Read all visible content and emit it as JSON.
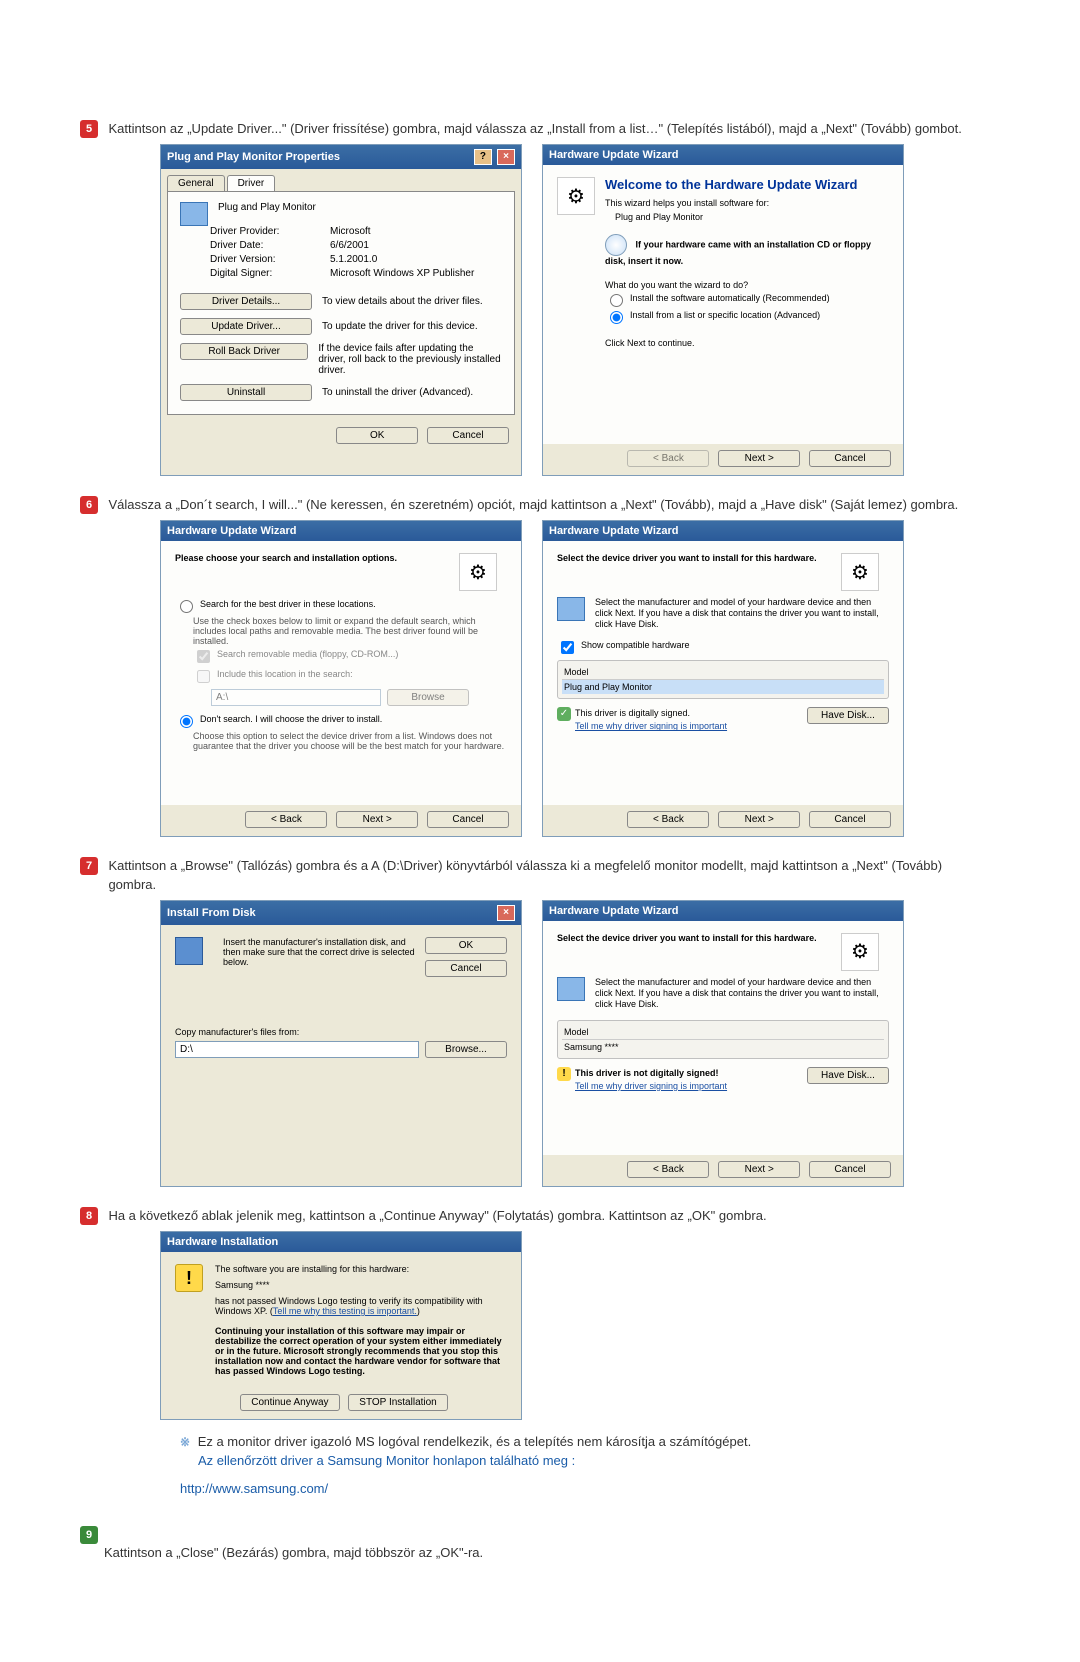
{
  "step5": {
    "num": "5",
    "text": "Kattintson az „Update Driver...\" (Driver frissítése) gombra, majd válassza az „Install from a list…\" (Telepítés listából), majd a „Next\" (Tovább) gombot.",
    "pnp": {
      "title": "Plug and Play Monitor Properties",
      "tab_general": "General",
      "tab_driver": "Driver",
      "device": "Plug and Play Monitor",
      "provider_l": "Driver Provider:",
      "provider_v": "Microsoft",
      "date_l": "Driver Date:",
      "date_v": "6/6/2001",
      "version_l": "Driver Version:",
      "version_v": "5.1.2001.0",
      "signer_l": "Digital Signer:",
      "signer_v": "Microsoft Windows XP Publisher",
      "details_btn": "Driver Details...",
      "details_txt": "To view details about the driver files.",
      "update_btn": "Update Driver...",
      "update_txt": "To update the driver for this device.",
      "rollback_btn": "Roll Back Driver",
      "rollback_txt": "If the device fails after updating the driver, roll back to the previously installed driver.",
      "uninstall_btn": "Uninstall",
      "uninstall_txt": "To uninstall the driver (Advanced).",
      "ok": "OK",
      "cancel": "Cancel"
    },
    "hw1": {
      "title": "Hardware Update Wizard",
      "heading": "Welcome to the Hardware Update Wizard",
      "intro": "This wizard helps you install software for:",
      "device": "Plug and Play Monitor",
      "cd_text": "If your hardware came with an installation CD or floppy disk, insert it now.",
      "question": "What do you want the wizard to do?",
      "opt1": "Install the software automatically (Recommended)",
      "opt2": "Install from a list or specific location (Advanced)",
      "continue": "Click Next to continue.",
      "back": "< Back",
      "next": "Next >",
      "cancel": "Cancel"
    }
  },
  "step6": {
    "num": "6",
    "text": "Válassza a „Don´t search, I will...\" (Ne keressen, én szeretném) opciót, majd kattintson a „Next\" (Tovább), majd a „Have disk\" (Saját lemez) gombra.",
    "hw2": {
      "title": "Hardware Update Wizard",
      "heading": "Please choose your search and installation options.",
      "opt1": "Search for the best driver in these locations.",
      "opt1_sub": "Use the check boxes below to limit or expand the default search, which includes local paths and removable media. The best driver found will be installed.",
      "chk1": "Search removable media (floppy, CD-ROM...)",
      "chk2": "Include this location in the search:",
      "path": "A:\\",
      "browse": "Browse",
      "opt2": "Don't search. I will choose the driver to install.",
      "opt2_sub": "Choose this option to select the device driver from a list. Windows does not guarantee that the driver you choose will be the best match for your hardware.",
      "back": "< Back",
      "next": "Next >",
      "cancel": "Cancel"
    },
    "hw3": {
      "title": "Hardware Update Wizard",
      "heading": "Select the device driver you want to install for this hardware.",
      "sub": "Select the manufacturer and model of your hardware device and then click Next. If you have a disk that contains the driver you want to install, click Have Disk.",
      "compat": "Show compatible hardware",
      "model_l": "Model",
      "model_v": "Plug and Play Monitor",
      "signed": "This driver is digitally signed.",
      "signed_link": "Tell me why driver signing is important",
      "have_disk": "Have Disk...",
      "back": "< Back",
      "next": "Next >",
      "cancel": "Cancel"
    }
  },
  "step7": {
    "num": "7",
    "text": "Kattintson a „Browse\" (Tallózás) gombra és a A (D:\\Driver) könyvtárból válassza ki a megfelelő monitor modellt, majd kattintson a „Next\" (Tovább) gombra.",
    "ifd": {
      "title": "Install From Disk",
      "msg": "Insert the manufacturer's installation disk, and then make sure that the correct drive is selected below.",
      "ok": "OK",
      "cancel": "Cancel",
      "copy": "Copy manufacturer's files from:",
      "path": "D:\\",
      "browse": "Browse..."
    },
    "hw4": {
      "title": "Hardware Update Wizard",
      "heading": "Select the device driver you want to install for this hardware.",
      "sub": "Select the manufacturer and model of your hardware device and then click Next. If you have a disk that contains the driver you want to install, click Have Disk.",
      "model_l": "Model",
      "model_v": "Samsung ****",
      "unsigned": "This driver is not digitally signed!",
      "unsigned_link": "Tell me why driver signing is important",
      "have_disk": "Have Disk...",
      "back": "< Back",
      "next": "Next >",
      "cancel": "Cancel"
    }
  },
  "step8": {
    "num": "8",
    "text": "Ha a következő ablak jelenik meg, kattintson a „Continue Anyway\" (Folytatás) gombra. Kattintson az „OK\" gombra.",
    "hi": {
      "title": "Hardware Installation",
      "line1": "The software you are installing for this hardware:",
      "line2": "Samsung ****",
      "line3a": "has not passed Windows Logo testing to verify its compatibility with Windows XP. (",
      "line3_link": "Tell me why this testing is important.",
      "line3b": ")",
      "para": "Continuing your installation of this software may impair or destabilize the correct operation of your system either immediately or in the future. Microsoft strongly recommends that you stop this installation now and contact the hardware vendor for software that has passed Windows Logo testing.",
      "cont": "Continue Anyway",
      "stop": "STOP Installation"
    },
    "foot1": "Ez a monitor driver igazoló MS logóval rendelkezik, és a telepítés nem károsítja a számítógépet.",
    "foot2": "Az ellenőrzött driver a Samsung Monitor honlapon található meg :",
    "url": "http://www.samsung.com/"
  },
  "step9": {
    "num": "9",
    "text": "Kattintson a „Close\" (Bezárás) gombra, majd többször az „OK\"-ra."
  }
}
